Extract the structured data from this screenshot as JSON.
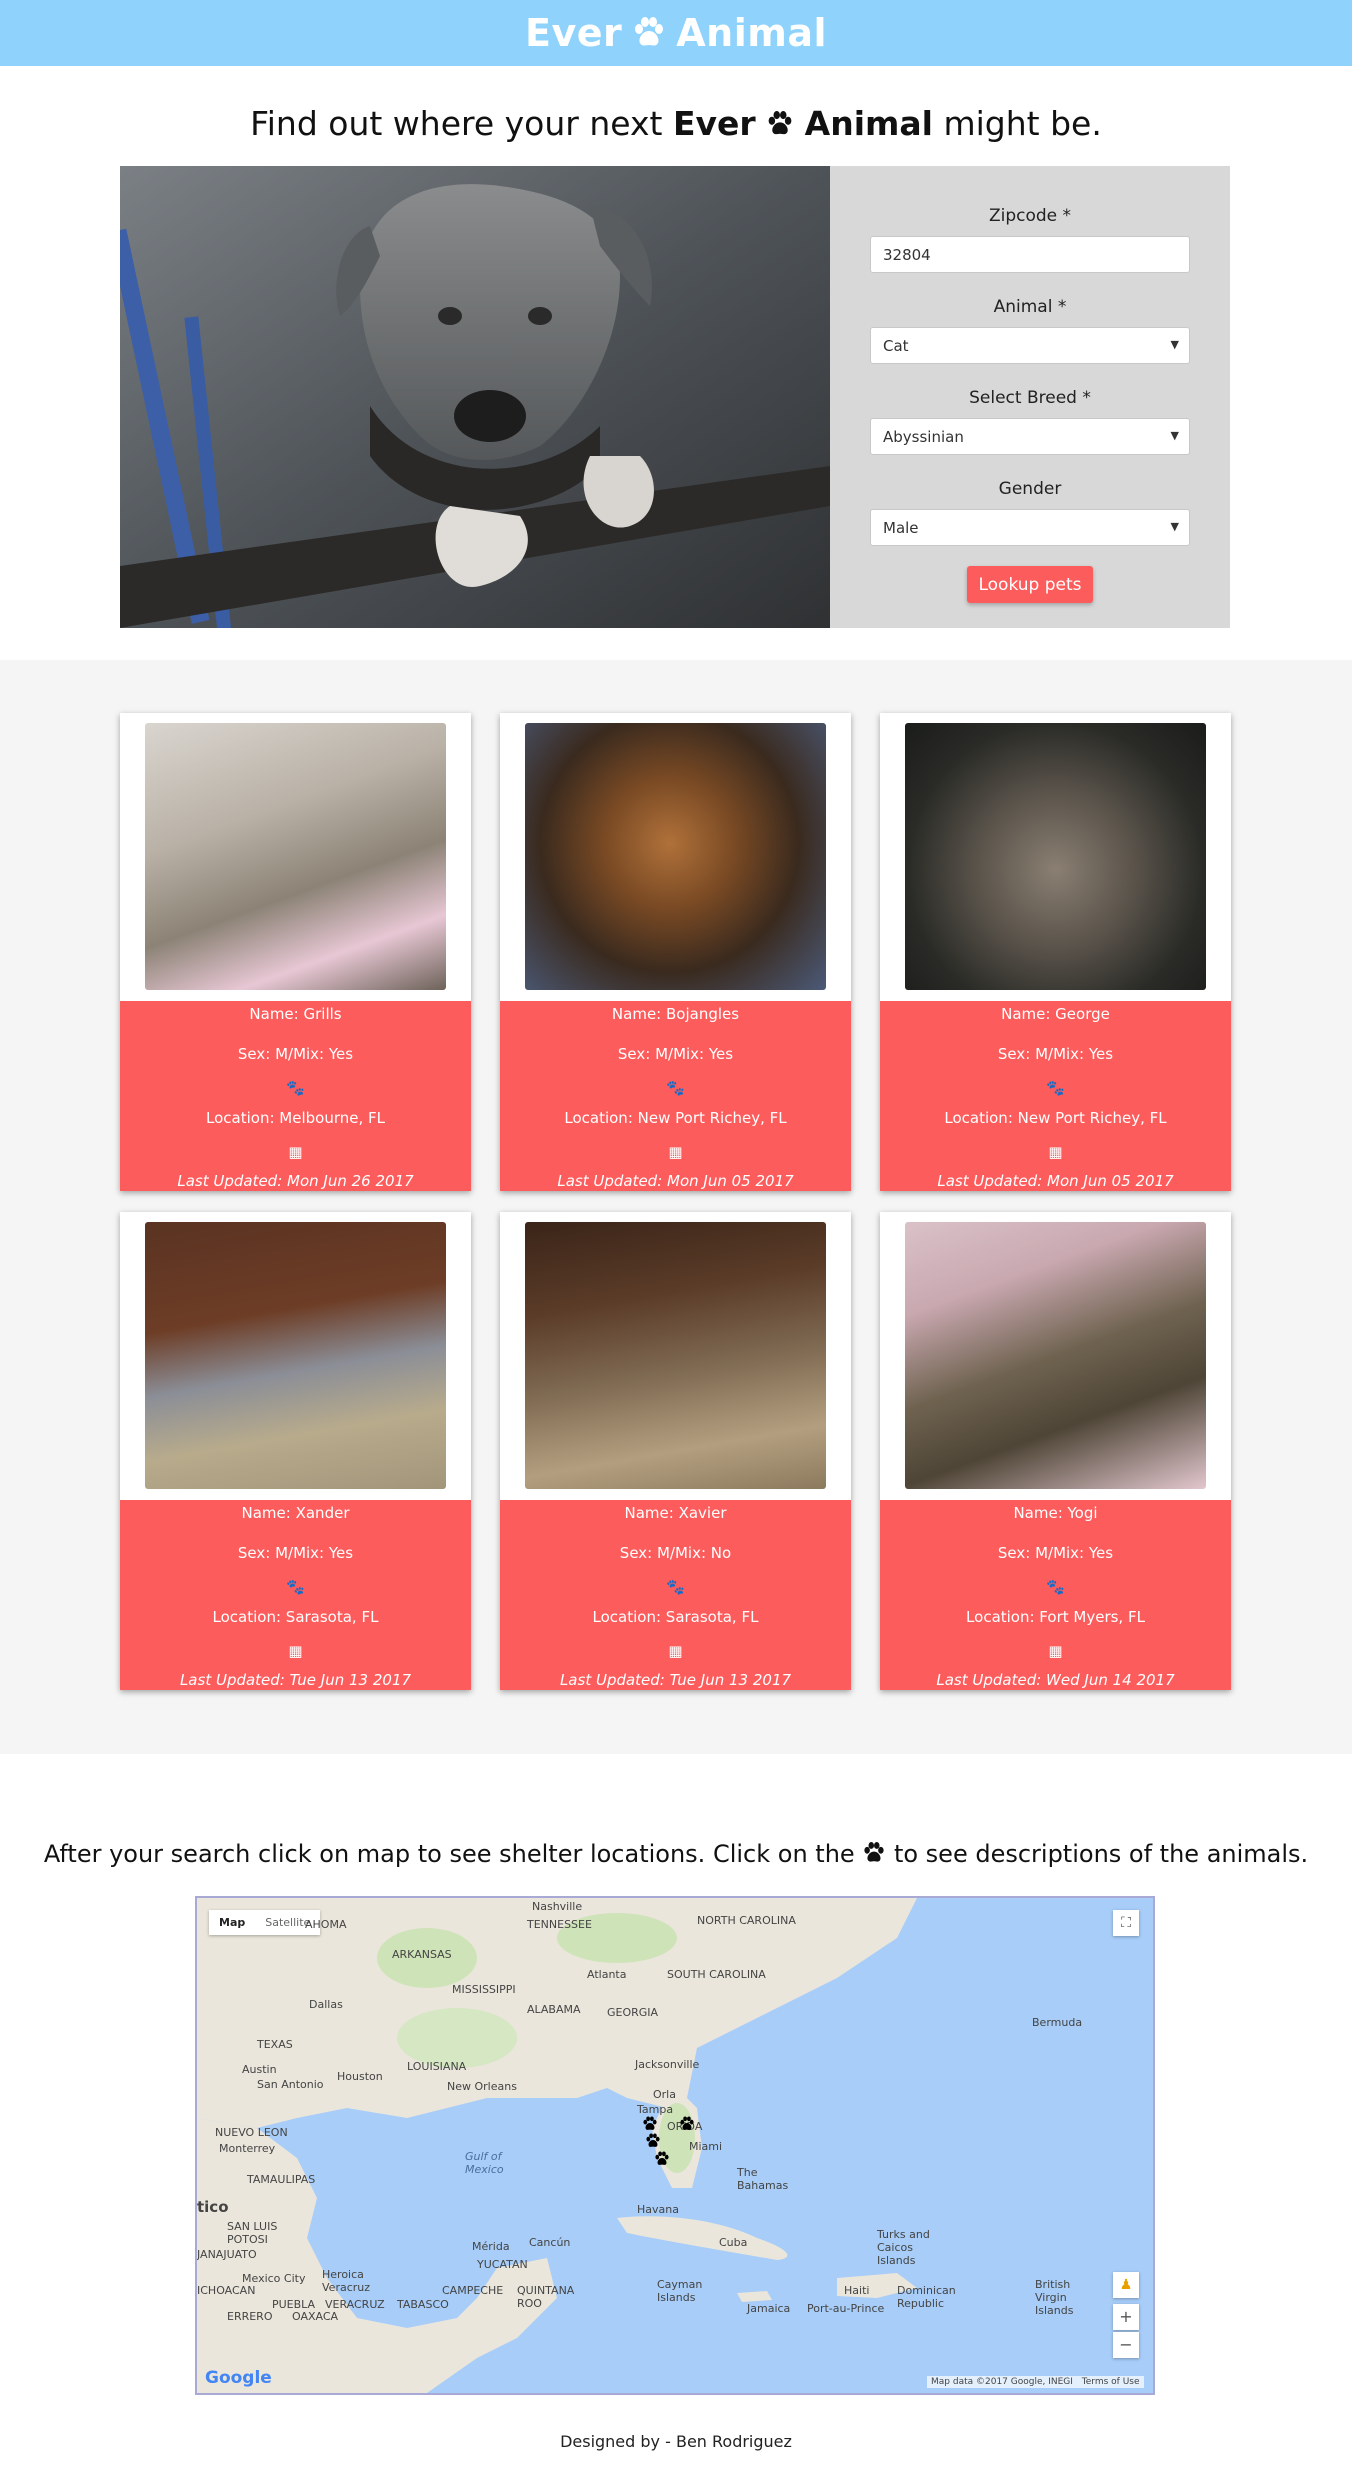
{
  "header": {
    "brand_left": "Ever",
    "brand_right": "Animal"
  },
  "headline": {
    "prefix": "Find out where your next",
    "brand_left": "Ever",
    "brand_right": "Animal",
    "suffix": "might be."
  },
  "form": {
    "zipcode_label": "Zipcode *",
    "zipcode_value": "32804",
    "animal_label": "Animal *",
    "animal_value": "Cat",
    "breed_label": "Select Breed *",
    "breed_value": "Abyssinian",
    "gender_label": "Gender",
    "gender_value": "Male",
    "submit_label": "Lookup pets"
  },
  "pets": [
    {
      "name": "Name: Grills",
      "sex": "Sex: M/Mix: Yes",
      "location": "Location: Melbourne, FL",
      "updated": "Last Updated: Mon Jun 26 2017"
    },
    {
      "name": "Name: Bojangles",
      "sex": "Sex: M/Mix: Yes",
      "location": "Location: New Port Richey, FL",
      "updated": "Last Updated: Mon Jun 05 2017"
    },
    {
      "name": "Name: George",
      "sex": "Sex: M/Mix: Yes",
      "location": "Location: New Port Richey, FL",
      "updated": "Last Updated: Mon Jun 05 2017"
    },
    {
      "name": "Name: Xander",
      "sex": "Sex: M/Mix: Yes",
      "location": "Location: Sarasota, FL",
      "updated": "Last Updated: Tue Jun 13 2017"
    },
    {
      "name": "Name: Xavier",
      "sex": "Sex: M/Mix: No",
      "location": "Location: Sarasota, FL",
      "updated": "Last Updated: Tue Jun 13 2017"
    },
    {
      "name": "Name: Yogi",
      "sex": "Sex: M/Mix: Yes",
      "location": "Location: Fort Myers, FL",
      "updated": "Last Updated: Wed Jun 14 2017"
    }
  ],
  "map_section": {
    "caption_prefix": "After your search click on map to see shelter locations. Click on the",
    "caption_suffix": "to see descriptions of the animals.",
    "map_tab": "Map",
    "satellite_tab": "Satellite",
    "attribution": "Map data ©2017 Google, INEGI",
    "terms": "Terms of Use",
    "google": "Google",
    "labels": {
      "nashville": "Nashville",
      "tennessee": "TENNESSEE",
      "north_carolina": "NORTH CAROLINA",
      "south_carolina": "SOUTH CAROLINA",
      "arkansas": "ARKANSAS",
      "oklahoma": "AHOMA",
      "atlanta": "Atlanta",
      "mississippi": "MISSISSIPPI",
      "alabama": "ALABAMA",
      "georgia": "GEORGIA",
      "dallas": "Dallas",
      "texas": "TEXAS",
      "louisiana": "LOUISIANA",
      "houston": "Houston",
      "austin": "Austin",
      "san_antonio": "San Antonio",
      "new_orleans": "New Orleans",
      "jacksonville": "Jacksonville",
      "orlando": "Orla",
      "tampa": "Tampa",
      "florida": "ORIDA",
      "miami": "Miami",
      "bermuda": "Bermuda",
      "nuevo_leon": "NUEVO LEON",
      "monterrey": "Monterrey",
      "gulf": "Gulf of Mexico",
      "bahamas": "The Bahamas",
      "tamaulipas": "TAMAULIPAS",
      "mexico": "tico",
      "havana": "Havana",
      "cuba": "Cuba",
      "san_luis": "SAN LUIS POTOSI",
      "juanajuato": "JANAJUATO",
      "merida": "Mérida",
      "cancun": "Cancún",
      "yucatan": "YUCATAN",
      "turks": "Turks and Caicos Islands",
      "mexico_city": "Mexico City",
      "heroica": "Heroica Veracruz",
      "campeche": "CAMPECHE",
      "quintana": "QUINTANA ROO",
      "cayman": "Cayman Islands",
      "haiti": "Haiti",
      "dominican": "Dominican Republic",
      "bvi": "British Virgin Islands",
      "jamaica": "Jamaica",
      "port_au_prince": "Port-au-Prince",
      "michoacan": "ICHOACAN",
      "puebla": "PUEBLA",
      "veracruz": "VERACRUZ",
      "tabasco": "TABASCO",
      "oaxaca": "OAXACA",
      "guerrero": "ERRERO"
    }
  },
  "footer": {
    "text": "Designed by - Ben Rodriguez"
  },
  "colors": {
    "header": "#8fd3fc",
    "accent": "#fd5c5c",
    "form_bg": "#d8d8d8",
    "results_bg": "#f5f5f5",
    "ocean": "#a7cdf8",
    "land": "#eae6dc"
  }
}
